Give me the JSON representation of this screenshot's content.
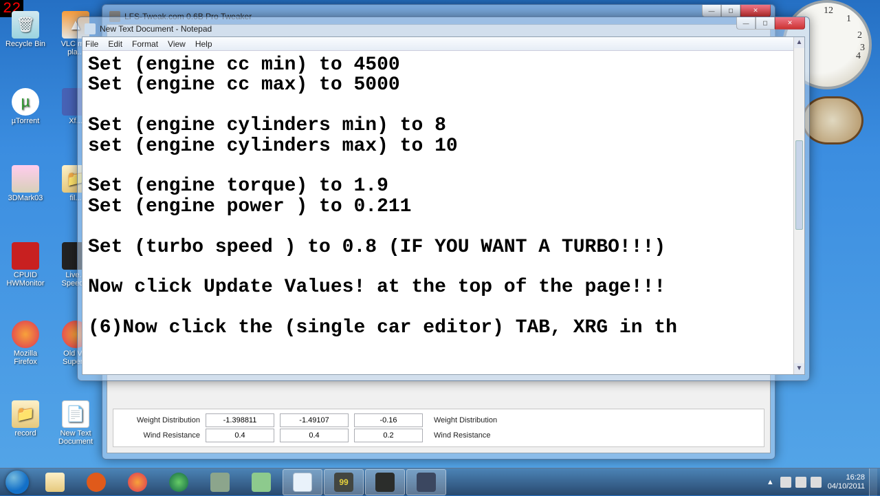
{
  "fps": "22",
  "desktop_icons": {
    "recycle": "Recycle Bin",
    "vlc": "VLC m...\npla...",
    "utorrent": "µTorrent",
    "xf": "Xf...",
    "3dmark": "3DMark03",
    "fil": "fil...",
    "cpuid": "CPUID\nHWMonitor",
    "live": "Live...\nSpeed...",
    "firefox": "Mozilla\nFirefox",
    "oldv": "Old V...\nSuper...",
    "record": "record",
    "newtxt": "New Text\nDocument"
  },
  "lfs": {
    "title": "LFS-Tweak.com 0.6B Pro Tweaker",
    "rows": [
      {
        "label": "Weight Distribution",
        "v1": "-1.398811",
        "v2": "-1.49107",
        "v3": "-0.16",
        "label2": "Weight Distribution"
      },
      {
        "label": "Wind Resistance",
        "v1": "0.4",
        "v2": "0.4",
        "v3": "0.2",
        "label2": "Wind Resistance"
      }
    ]
  },
  "notepad": {
    "title": "New Text Document - Notepad",
    "menu": {
      "file": "File",
      "edit": "Edit",
      "format": "Format",
      "view": "View",
      "help": "Help"
    },
    "content": "Set (engine cc min) to 4500\nSet (engine cc max) to 5000\n\nSet (engine cylinders min) to 8\nset (engine cylinders max) to 10\n\nSet (engine torque) to 1.9\nSet (engine power ) to 0.211\n\nSet (turbo speed ) to 0.8 (IF YOU WANT A TURBO!!!)\n\nNow click Update Values! at the top of the page!!!\n\n(6)Now click the (single car editor) TAB, XRG in th"
  },
  "tray": {
    "time": "16:28",
    "date": "04/10/2011"
  }
}
